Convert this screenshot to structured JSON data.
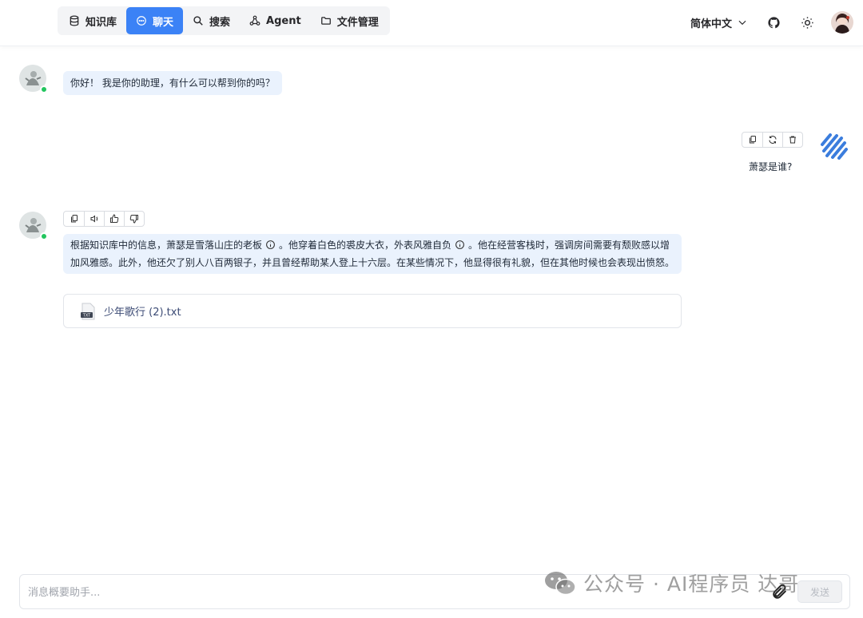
{
  "header": {
    "tabs": [
      {
        "label": "知识库",
        "icon": "database-icon"
      },
      {
        "label": "聊天",
        "icon": "chat-icon",
        "active": true
      },
      {
        "label": "搜索",
        "icon": "search-icon"
      },
      {
        "label": "Agent",
        "icon": "graph-icon"
      },
      {
        "label": "文件管理",
        "icon": "folder-icon"
      }
    ],
    "language": "简体中文",
    "accent_color": "#3b82f6"
  },
  "messages": {
    "greeting": "你好！ 我是你的助理，有什么可以帮到你的吗？",
    "user_question": "萧瑟是谁?",
    "answer_part1": "根据知识库中的信息，萧瑟是雪落山庄的老板",
    "answer_part2": "。他穿着白色的裘皮大衣，外表风雅自负",
    "answer_part3": "。他在经营客栈时，强调房间需要有颓败感以增加风雅感。此外，他还欠了别人八百两银子，并且曾经帮助某人登上十六层。在某些情况下，他显得很有礼貌，但在其他时候也会表现出愤怒。",
    "source_file": "少年歌行 (2).txt",
    "file_badge": "TXT"
  },
  "composer": {
    "placeholder": "消息概要助手...",
    "value": "",
    "send_label": "发送"
  },
  "watermark": "公众号 · AI程序员 达哥"
}
